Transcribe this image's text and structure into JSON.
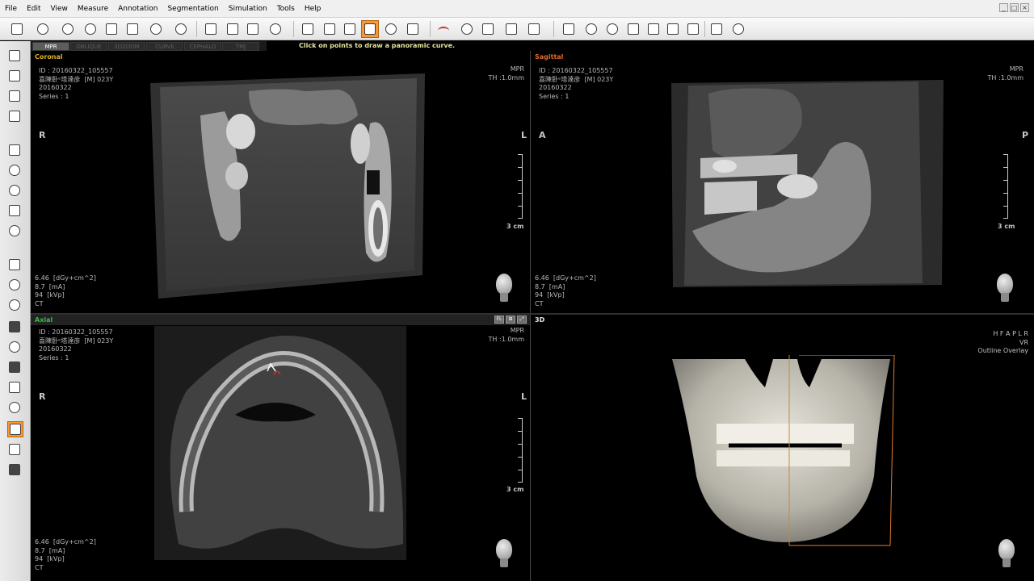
{
  "menu": [
    "File",
    "Edit",
    "View",
    "Measure",
    "Annotation",
    "Segmentation",
    "Simulation",
    "Tools",
    "Help"
  ],
  "window_controls": [
    "_",
    "□",
    "×"
  ],
  "tabs": [
    {
      "label": "MPR",
      "active": true
    },
    {
      "label": "OBLIQUE",
      "active": false
    },
    {
      "label": "3DZOOM",
      "active": false
    },
    {
      "label": "CURVE",
      "active": false
    },
    {
      "label": "CEPHALO",
      "active": false
    },
    {
      "label": "TMJ",
      "active": false
    }
  ],
  "hint": "Click on points to draw a panoramic curve.",
  "toolbar_icons": [
    "ruler-icon",
    "angle-icon",
    "cloud-icon",
    "3d-mode-icon",
    "histogram-icon",
    "grid-icon",
    "globe-icon",
    "density-icon",
    "select-arrow-icon",
    "text-icon",
    "pen-icon",
    "shape-icon",
    "note-icon",
    "report-icon",
    "image-icon",
    "layer-icon",
    "surface-icon",
    "export-icon",
    "curve-icon",
    "rotate-icon",
    "dental-arch-icon",
    "nerve-icon",
    "implant-icon",
    "camera-icon",
    "user-icon",
    "disc-icon",
    "print-icon",
    "save-icon",
    "hide-icon",
    "settings-icon",
    "tools-icon"
  ],
  "sidebar_icons": [
    "open-folder-icon",
    "import-icon",
    "save-icon",
    "print-icon",
    "undo-icon",
    "undo-arrow-icon",
    "redo-icon",
    "delete-icon",
    "reset-icon",
    "move-icon",
    "contrast-icon",
    "zoom-icon",
    "window-level-icon",
    "brightness-icon",
    "gradient-icon",
    "layout-icon",
    "search-icon",
    "annotation-icon",
    "flip-icon",
    "checker-icon"
  ],
  "patient": {
    "id": "ID : 20160322_105557",
    "name": "喜陳卧ᵉ塔達彦  [M] 023Y",
    "date": "20160322",
    "series": "Series : 1",
    "dose": "6.46  [dGy+cm^2]",
    "ma": "8.7  [mA]",
    "kvp": "94  [kVp]",
    "modality": "CT"
  },
  "coronal": {
    "title": "Coronal",
    "mode": "MPR",
    "th": "TH :1.0mm",
    "left": "R",
    "right": "L",
    "scale": "3 cm"
  },
  "sagittal": {
    "title": "Sagittal",
    "mode": "MPR",
    "th": "TH :1.0mm",
    "left": "A",
    "right": "P",
    "scale": "3 cm"
  },
  "axial": {
    "title": "Axial",
    "mode": "MPR",
    "th": "TH :1.0mm",
    "left": "R",
    "right": "L",
    "scale": "3 cm",
    "mini": [
      "FL",
      "⊞",
      "⤢"
    ]
  },
  "vr3d": {
    "title": "3D",
    "orient": "H F A P L R",
    "mode": "VR",
    "overlay": "Outline Overlay"
  },
  "colors": {
    "coronal_title": "#e0b020",
    "sagittal_title": "#e06a2a",
    "axial_title": "#3cba4a",
    "title_3d": "#e8e8e8",
    "accent": "#f39a3c"
  }
}
